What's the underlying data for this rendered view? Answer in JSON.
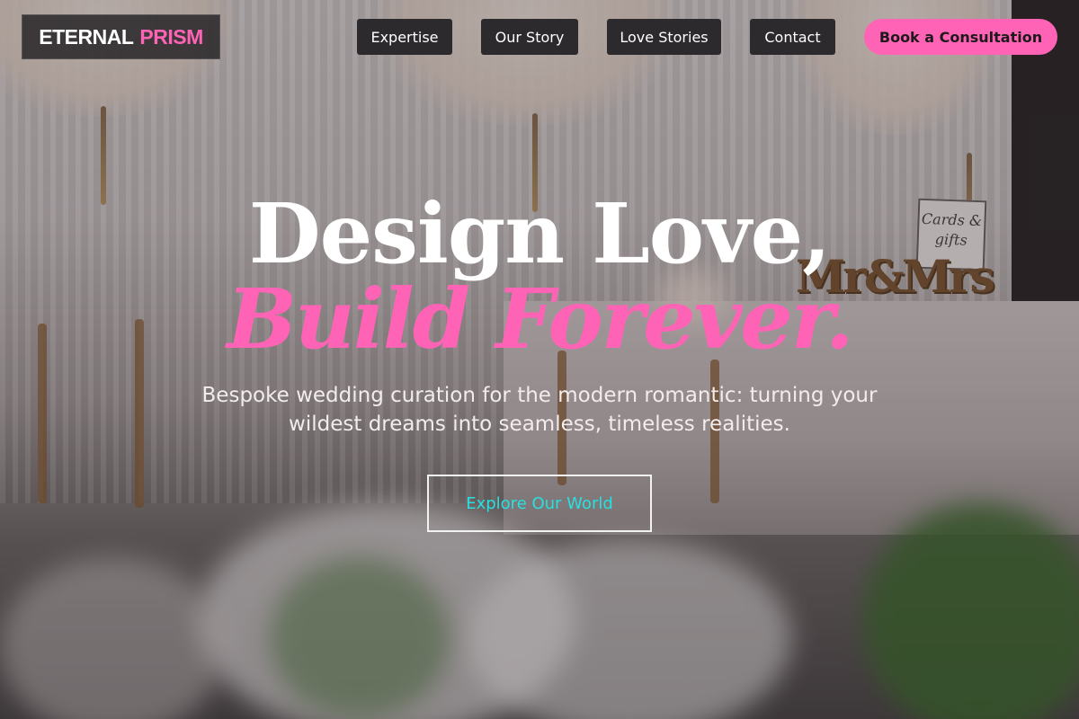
{
  "brand": {
    "part1": "ETERNAL",
    "part2": "PRISM",
    "accent_color": "#ff63b6"
  },
  "nav": {
    "items": [
      {
        "label": "Expertise"
      },
      {
        "label": "Our Story"
      },
      {
        "label": "Love Stories"
      },
      {
        "label": "Contact"
      }
    ],
    "cta_label": "Book a Consultation"
  },
  "hero": {
    "title_line1": "Design Love,",
    "title_line2": "Build Forever.",
    "subtitle": "Bespoke wedding curation for the modern romantic: turning your wildest dreams into seamless, timeless realities.",
    "button_label": "Explore Our World",
    "button_text_color": "#27e0e0"
  },
  "decor": {
    "cards_sign": "Cards & gifts",
    "mr_mrs_sign": "Mr&Mrs"
  }
}
